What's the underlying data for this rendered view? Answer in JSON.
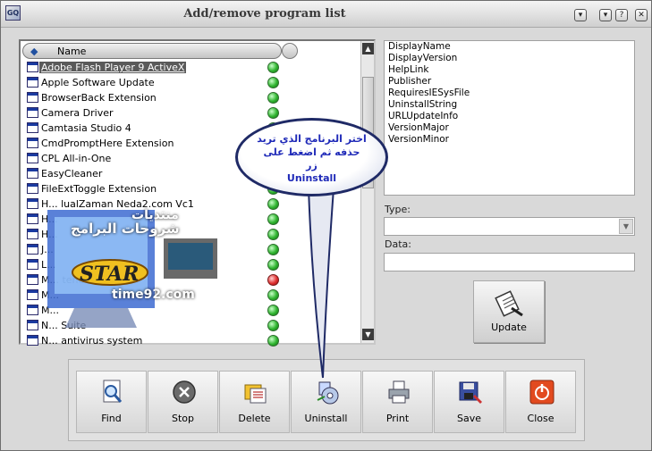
{
  "window": {
    "title": "Add/remove program list",
    "app_icon": "program-list-icon",
    "controls": [
      "minimize-icon",
      "restore-icon",
      "help-icon",
      "close-icon"
    ]
  },
  "list": {
    "header": {
      "column": "Name"
    },
    "items": [
      {
        "name": "Adobe Flash Player 9 ActiveX",
        "status": "green",
        "selected": true
      },
      {
        "name": "Apple Software Update",
        "status": "green"
      },
      {
        "name": "BrowserBack Extension",
        "status": "green"
      },
      {
        "name": "Camera Driver",
        "status": "green"
      },
      {
        "name": "Camtasia Studio 4",
        "status": "green"
      },
      {
        "name": "CmdPromptHere Extension",
        "status": "green"
      },
      {
        "name": "CPL All-in-One",
        "status": "green"
      },
      {
        "name": "EasyCleaner",
        "status": "green"
      },
      {
        "name": "FileExtToggle Extension",
        "status": "green"
      },
      {
        "name": "H... lualZaman Neda2.com Vc1",
        "status": "green"
      },
      {
        "name": "H...",
        "status": "green"
      },
      {
        "name": "H...",
        "status": "green"
      },
      {
        "name": "J...",
        "status": "green"
      },
      {
        "name": "L...",
        "status": "green"
      },
      {
        "name": "M... tend",
        "status": "red"
      },
      {
        "name": "M...",
        "status": "green"
      },
      {
        "name": "M...",
        "status": "green"
      },
      {
        "name": "N... Suite",
        "status": "green"
      },
      {
        "name": "N... antivirus system",
        "status": "green"
      }
    ]
  },
  "properties": {
    "fields": [
      "DisplayName",
      "DisplayVersion",
      "HelpLink",
      "Publisher",
      "RequiresIESysFile",
      "UninstallString",
      "URLUpdateInfo",
      "VersionMajor",
      "VersionMinor"
    ]
  },
  "type_field": {
    "label": "Type:",
    "value": ""
  },
  "data_field": {
    "label": "Data:",
    "value": ""
  },
  "update_button": {
    "label": "Update",
    "icon": "update-icon"
  },
  "toolbar": {
    "find": "Find",
    "stop": "Stop",
    "delete": "Delete",
    "uninstall": "Uninstall",
    "print": "Print",
    "save": "Save",
    "close": "Close"
  },
  "annotation": {
    "line1": "اختر البرنامج الذي تريد",
    "line2": "حذفه ثم اضغط على",
    "line3": "زر",
    "line4": "Uninstall"
  },
  "watermark": {
    "arabic_top": "منتديات",
    "arabic_mid": "شروحات البرامج",
    "brand": "STAR",
    "url": "time92.com"
  },
  "colors": {
    "green_status": "#2fb42f",
    "red_status": "#e03030",
    "selection": "#5a5a5a",
    "bubble_text": "#1f2ab8"
  }
}
